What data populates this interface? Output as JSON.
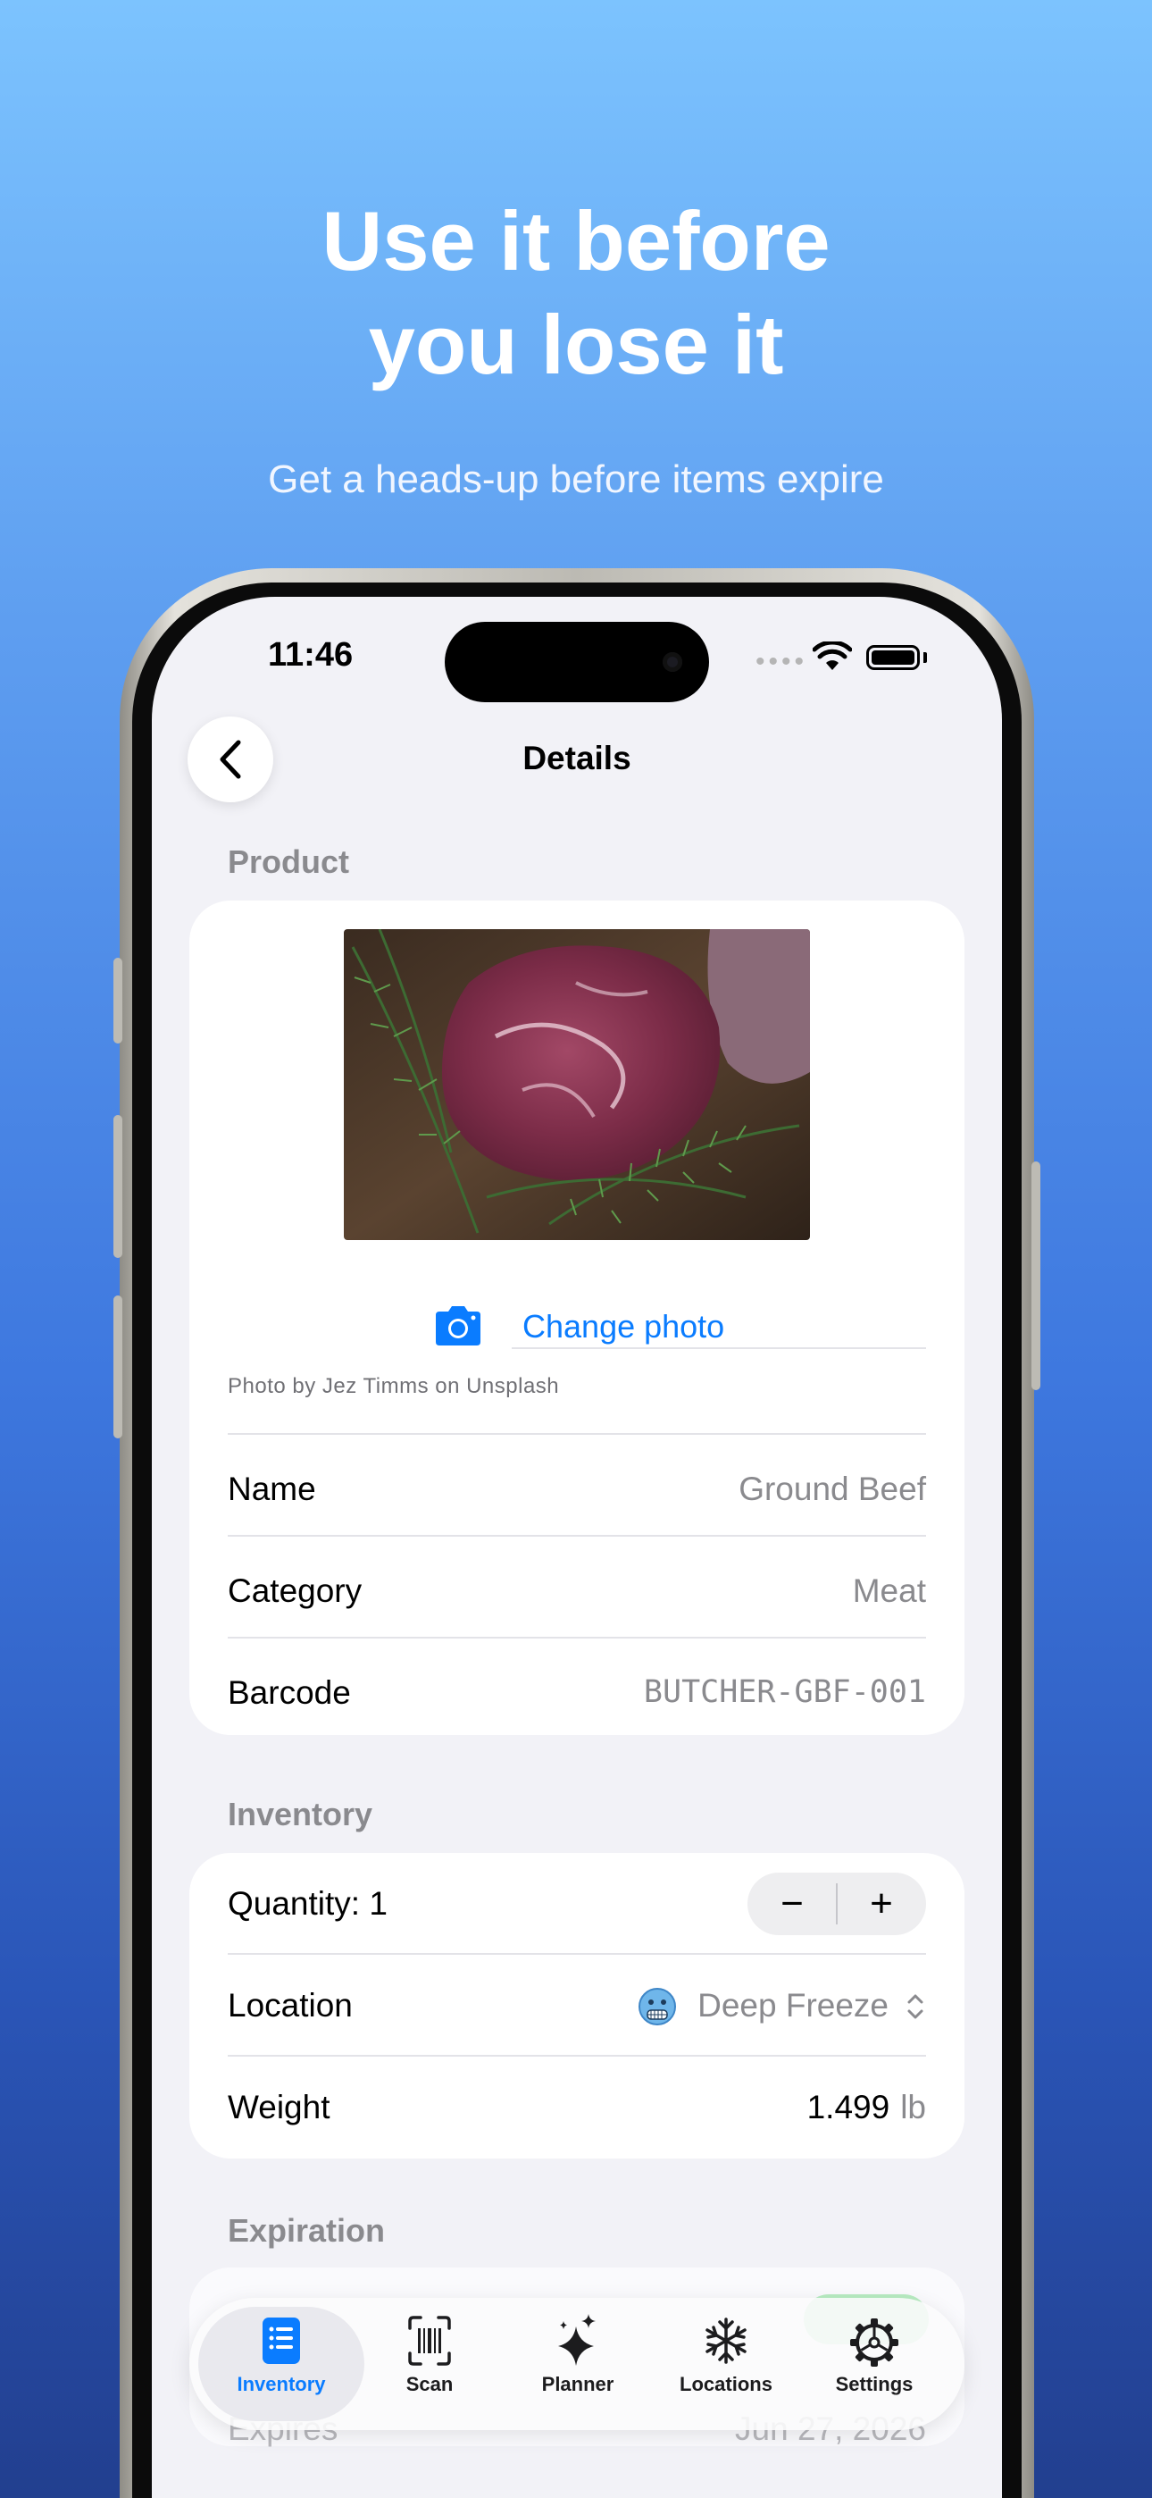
{
  "marketing": {
    "headline_line1": "Use it before",
    "headline_line2": "you lose it",
    "subheadline": "Get a heads-up before items expire"
  },
  "status_bar": {
    "time": "11:46"
  },
  "nav": {
    "title": "Details",
    "back_icon": "chevron-left-icon"
  },
  "product": {
    "section_header": "Product",
    "change_photo_label": "Change photo",
    "photo_credit": "Photo by Jez Timms on Unsplash",
    "fields": [
      {
        "label": "Name",
        "value": "Ground Beef"
      },
      {
        "label": "Category",
        "value": "Meat"
      },
      {
        "label": "Barcode",
        "value": "BUTCHER-GBF-001"
      }
    ]
  },
  "inventory": {
    "section_header": "Inventory",
    "quantity_label": "Quantity: 1",
    "decrement_label": "−",
    "increment_label": "+",
    "location_label": "Location",
    "location_value": "Deep Freeze",
    "weight_label": "Weight",
    "weight_value": "1.499",
    "weight_unit": "lb"
  },
  "expiration": {
    "section_header": "Expiration",
    "expires_label": "Expires",
    "expires_value": "Jun 27, 2026"
  },
  "tabbar": {
    "tabs": [
      {
        "label": "Inventory",
        "icon": "list-icon",
        "active": true
      },
      {
        "label": "Scan",
        "icon": "barcode-viewfinder-icon",
        "active": false
      },
      {
        "label": "Planner",
        "icon": "sparkles-icon",
        "active": false
      },
      {
        "label": "Locations",
        "icon": "snowflake-icon",
        "active": false
      },
      {
        "label": "Settings",
        "icon": "gear-icon",
        "active": false
      }
    ]
  },
  "colors": {
    "accent": "#0a7cff",
    "background_top": "#7cc3fe",
    "background_bottom": "#223f8f"
  }
}
